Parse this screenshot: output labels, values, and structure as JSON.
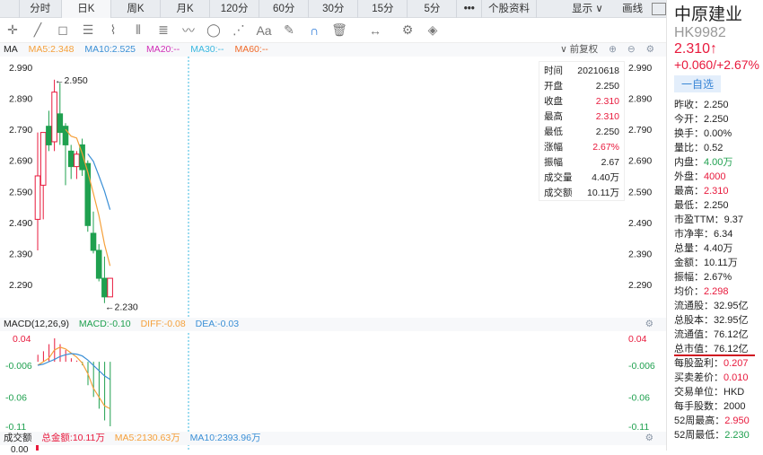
{
  "tabs": [
    "分时",
    "日K",
    "周K",
    "月K",
    "120分",
    "60分",
    "30分",
    "15分",
    "5分",
    "•••",
    "个股资料",
    "显示 ∨",
    "画线"
  ],
  "ma_legend": {
    "label": "MA",
    "ma5": "MA5:2.348",
    "ma10": "MA10:2.525",
    "ma20": "MA20:--",
    "ma30": "MA30:--",
    "ma60": "MA60:--",
    "adjust": "∨ 前复权"
  },
  "colors": {
    "up": "#e8193c",
    "down": "#1fa04f",
    "ma5": "#f5a03a",
    "ma10": "#3a8fd6",
    "ma20": "#d12fb8",
    "ma30": "#3ab8e0",
    "ma60": "#f06a2a"
  },
  "price_axis": [
    "2.990",
    "2.890",
    "2.790",
    "2.690",
    "2.590",
    "2.490",
    "2.390",
    "2.290"
  ],
  "high_mark": "←2.950",
  "low_mark": "←2.230",
  "candles": [
    [
      2.5,
      2.78,
      2.4,
      2.64
    ],
    [
      2.61,
      2.78,
      2.5,
      2.78
    ],
    [
      2.8,
      2.85,
      2.72,
      2.74
    ],
    [
      2.75,
      2.95,
      2.72,
      2.91
    ],
    [
      2.84,
      2.94,
      2.74,
      2.78
    ],
    [
      2.8,
      2.81,
      2.61,
      2.74
    ],
    [
      2.72,
      2.74,
      2.63,
      2.67
    ],
    [
      2.67,
      2.72,
      2.63,
      2.71
    ],
    [
      2.74,
      2.76,
      2.64,
      2.66
    ],
    [
      2.68,
      2.69,
      2.46,
      2.48
    ],
    [
      2.455,
      2.525,
      2.39,
      2.4
    ],
    [
      2.4,
      2.42,
      2.3,
      2.31
    ],
    [
      2.31,
      2.38,
      2.23,
      2.25
    ],
    [
      2.25,
      2.31,
      2.25,
      2.31
    ]
  ],
  "info_box": [
    [
      "时间",
      "20210618",
      ""
    ],
    [
      "开盘",
      "2.250",
      ""
    ],
    [
      "收盘",
      "2.310",
      "red"
    ],
    [
      "最高",
      "2.310",
      "red"
    ],
    [
      "最低",
      "2.250",
      ""
    ],
    [
      "涨幅",
      "2.67%",
      "red"
    ],
    [
      "振幅",
      "2.67",
      ""
    ],
    [
      "成交量",
      "4.40万",
      ""
    ],
    [
      "成交额",
      "10.11万",
      ""
    ]
  ],
  "macd": {
    "label": "MACD(12,26,9)",
    "macd": "MACD:-0.10",
    "diff": "DIFF:-0.08",
    "dea": "DEA:-0.03",
    "axis": [
      "0.04",
      "-0.006",
      "-0.06",
      "-0.11"
    ],
    "hist": [
      0,
      0.012,
      0.018,
      0.03,
      0.04,
      0.03,
      0.02,
      0.006,
      0.002,
      -0.006,
      -0.04,
      -0.06,
      -0.08,
      -0.1,
      -0.11
    ],
    "diff_line": [
      -0.006,
      0.0,
      0.006,
      0.02,
      0.025,
      0.022,
      0.015,
      0.008,
      -0.002,
      -0.02,
      -0.045,
      -0.06,
      -0.075,
      -0.08
    ],
    "dea_line": [
      -0.006,
      -0.004,
      0.0,
      0.004,
      0.009,
      0.012,
      0.014,
      0.013,
      0.01,
      0.003,
      -0.006,
      -0.015,
      -0.024,
      -0.03
    ]
  },
  "volume": {
    "label": "成交额",
    "total": "总金额:10.11万",
    "ma5": "MA5:2130.63万",
    "ma10": "MA10:2393.96万",
    "axis": "0.00"
  },
  "side": {
    "name": "中原建业",
    "code": "HK9982",
    "price": "2.310↑",
    "change": "+0.060/+2.67%",
    "fav": "一自选",
    "rows": [
      [
        "昨收：",
        "2.250",
        ""
      ],
      [
        "今开：",
        "2.250",
        ""
      ],
      [
        "换手：",
        "0.00%",
        ""
      ],
      [
        "量比：",
        "0.52",
        ""
      ],
      [
        "内盘：",
        "4.00万",
        "green"
      ],
      [
        "外盘：",
        "4000",
        "red"
      ],
      [
        "最高：",
        "2.310",
        "red"
      ],
      [
        "最低：",
        "2.250",
        ""
      ],
      [
        "市盈TTM：",
        "9.37",
        ""
      ],
      [
        "市净率：",
        "6.34",
        ""
      ],
      [
        "总量：",
        "4.40万",
        ""
      ],
      [
        "金额：",
        "10.11万",
        ""
      ],
      [
        "振幅：",
        "2.67%",
        ""
      ],
      [
        "均价：",
        "2.298",
        "red"
      ],
      [
        "流通股：",
        "32.95亿",
        ""
      ],
      [
        "总股本：",
        "32.95亿",
        ""
      ],
      [
        "流通值：",
        "76.12亿",
        ""
      ],
      [
        "总市值：",
        "76.12亿",
        ""
      ],
      [
        "每股盈利：",
        "0.207",
        "red"
      ],
      [
        "买卖差价：",
        "0.010",
        "red"
      ],
      [
        "交易单位：",
        "HKD",
        ""
      ],
      [
        "每手股数：",
        "2000",
        ""
      ],
      [
        "52周最高：",
        "2.950",
        "red"
      ],
      [
        "52周最低：",
        "2.230",
        "green"
      ]
    ]
  }
}
